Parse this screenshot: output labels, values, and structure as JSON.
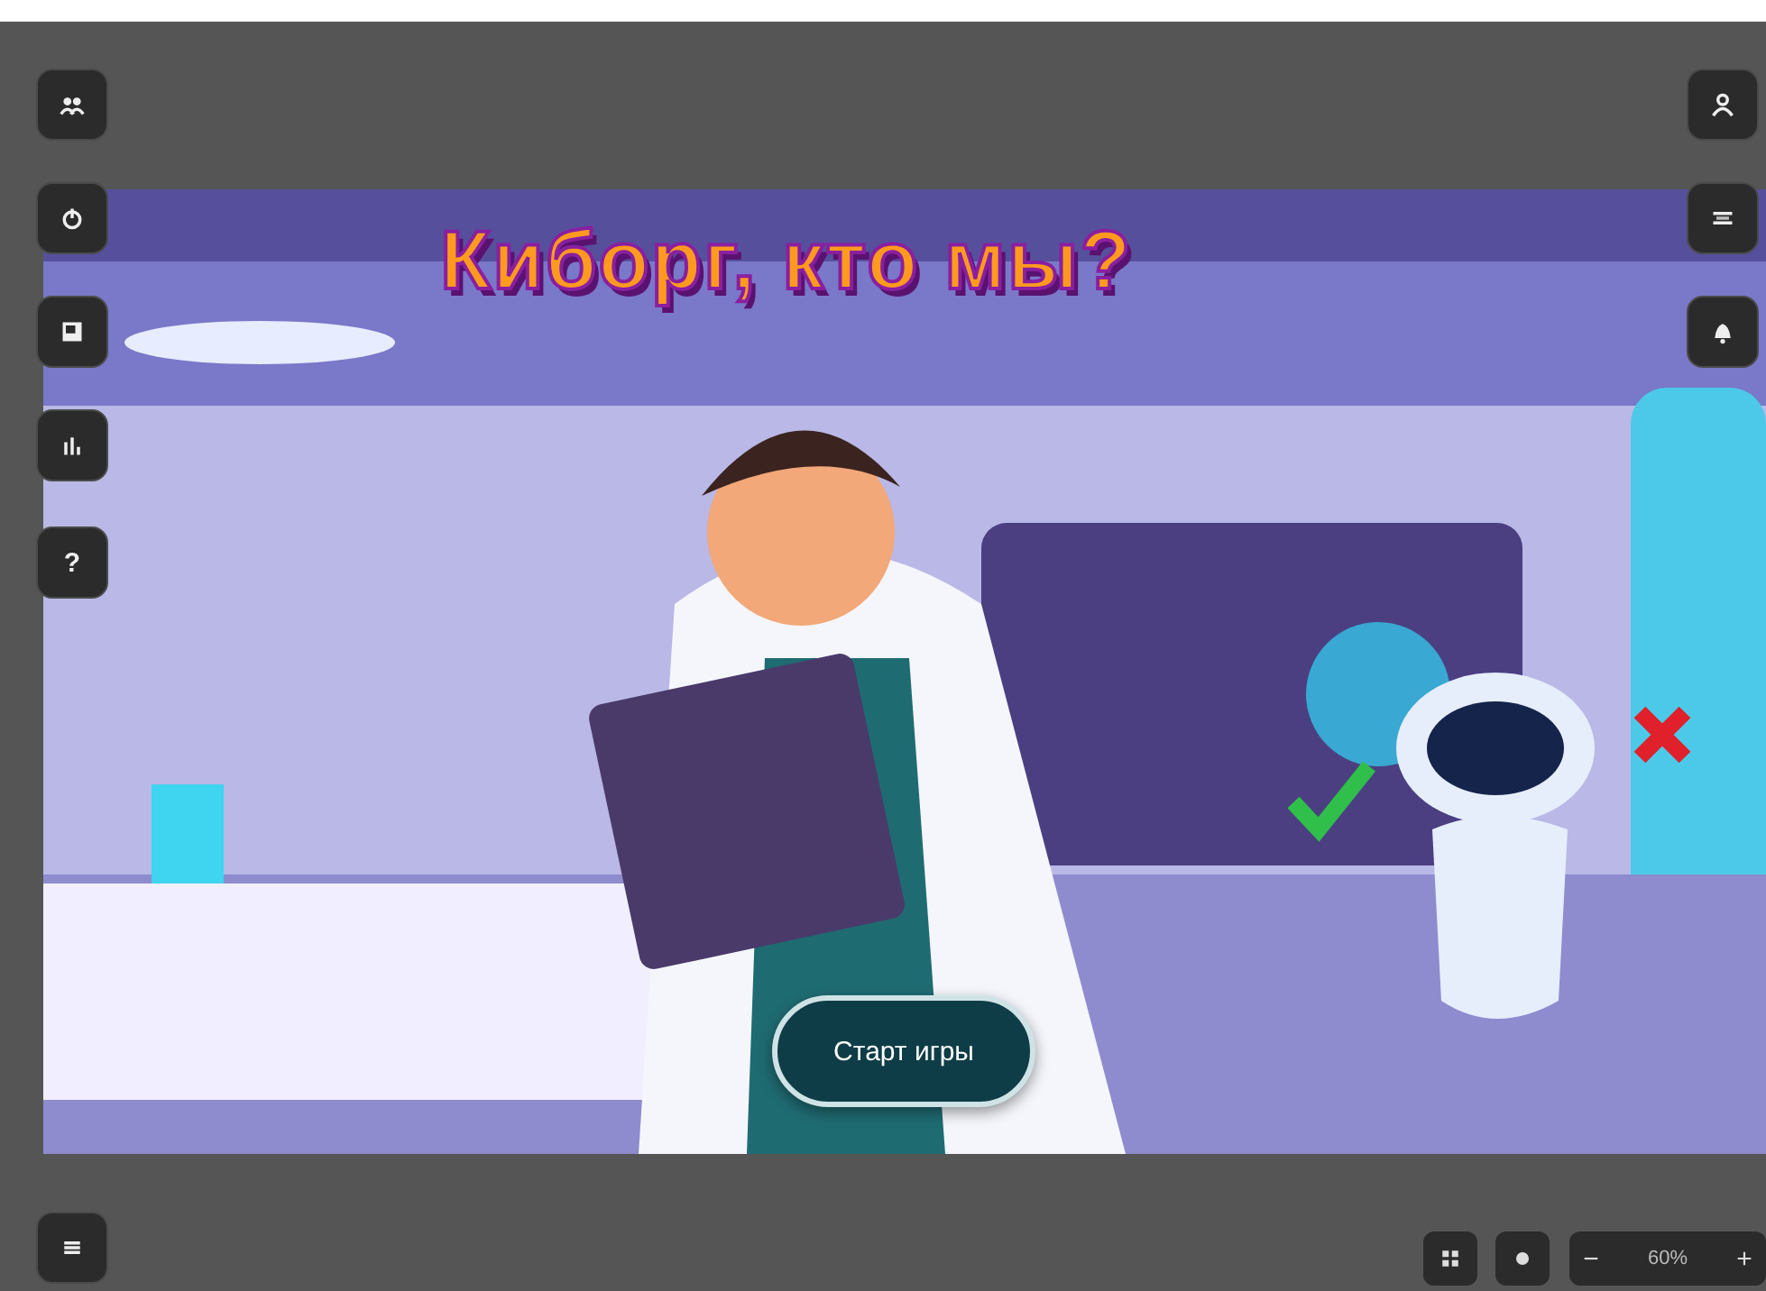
{
  "game": {
    "title": "Киборг, кто мы?",
    "start_button": "Старт игры"
  },
  "help_button": "?",
  "zoom": {
    "minus": "−",
    "value": "60%",
    "plus": "+"
  }
}
